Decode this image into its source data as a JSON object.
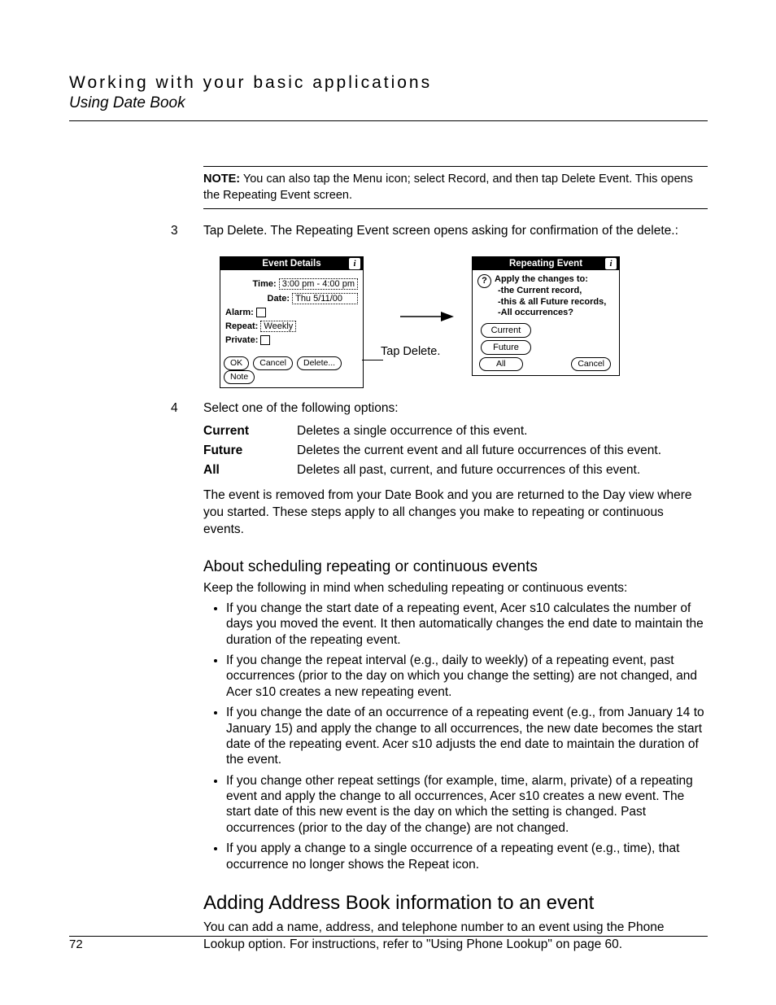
{
  "header": {
    "title": "Working with your basic applications",
    "subtitle": "Using Date Book"
  },
  "note": {
    "label": "NOTE:",
    "text": "You can also tap the Menu icon; select Record, and then tap Delete Event. This opens the Repeating Event screen."
  },
  "step3": {
    "num": "3",
    "text": "Tap Delete. The Repeating Event screen opens asking for confirmation of the delete.:"
  },
  "fig": {
    "left": {
      "title": "Event Details",
      "time_k": "Time:",
      "time_v": "3:00 pm - 4:00 pm",
      "date_k": "Date:",
      "date_v": "Thu 5/11/00",
      "alarm_k": "Alarm:",
      "repeat_k": "Repeat:",
      "repeat_v": "Weekly",
      "private_k": "Private:",
      "btn_ok": "OK",
      "btn_cancel": "Cancel",
      "btn_delete": "Delete...",
      "btn_note": "Note"
    },
    "tap": "Tap Delete.",
    "right": {
      "title": "Repeating Event",
      "q": "Apply the changes to:",
      "l1": "-the Current record,",
      "l2": "-this & all Future records,",
      "l3": "-All occurrences?",
      "b_current": "Current",
      "b_future": "Future",
      "b_all": "All",
      "b_cancel": "Cancel"
    }
  },
  "step4": {
    "num": "4",
    "text": "Select one of the following options:"
  },
  "opts": {
    "current_k": "Current",
    "current_v": "Deletes a single occurrence of this event.",
    "future_k": "Future",
    "future_v": "Deletes the current event and all future occurrences of this event.",
    "all_k": "All",
    "all_v": "Deletes all past, current, and future occurrences of this event."
  },
  "after": "The event is removed from your Date Book and you are returned to the Day view where you started. These steps apply to all changes you make to repeating or continuous events.",
  "h2": "About scheduling repeating or continuous events",
  "h2_intro": "Keep the following in mind when scheduling repeating or continuous events:",
  "tips": [
    "If you change the start date of a repeating event, Acer s10 calculates the number of days you moved the event. It then automatically changes the end date to maintain the duration of the repeating event.",
    "If you change the repeat interval (e.g., daily to weekly) of a repeating event, past occurrences (prior to the day on which you change the setting) are not changed, and Acer s10 creates a new repeating event.",
    "If you change the date of an occurrence of a repeating event (e.g., from January 14 to January 15) and apply the change to all occurrences, the new date becomes the start date of the repeating event. Acer s10 adjusts the end date to maintain the duration of the event.",
    "If you change other repeat settings (for example, time, alarm, private) of a repeating event and apply the change to all occurrences, Acer s10 creates a new event. The start date of this new event is the day on which the setting is changed. Past occurrences (prior to the day of the change) are not changed.",
    "If you apply a change to a single occurrence of a repeating event (e.g., time), that occurrence no longer shows the Repeat icon."
  ],
  "h1c": "Adding Address Book information to an event",
  "h1c_body": "You can add a name, address, and telephone number to an event using the Phone Lookup option. For instructions, refer to \"Using Phone Lookup\" on page 60.",
  "pagenum": "72"
}
